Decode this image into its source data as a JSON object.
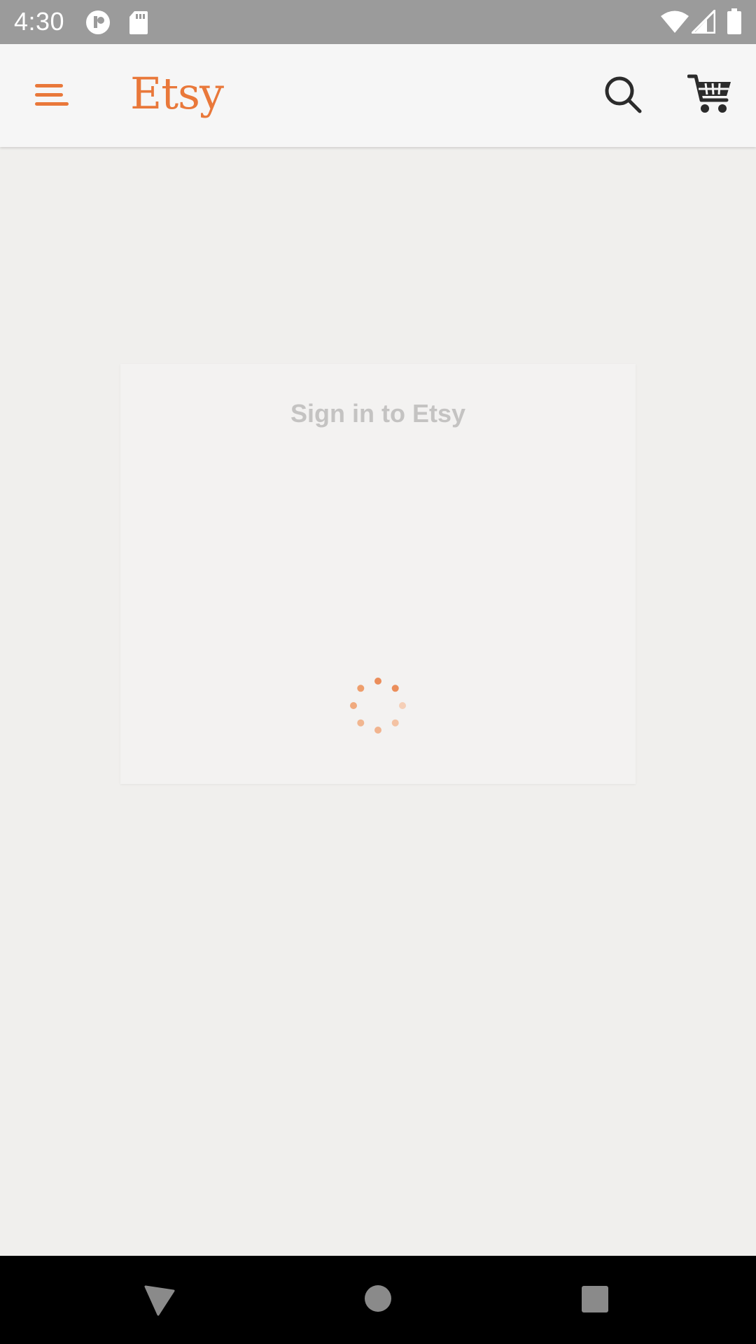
{
  "status_bar": {
    "time": "4:30",
    "icons": [
      "app-notification-icon",
      "sd-card-icon",
      "wifi-icon",
      "cell-signal-icon",
      "battery-icon"
    ]
  },
  "app_bar": {
    "menu_icon": "hamburger-menu-icon",
    "logo_text": "Etsy",
    "search_icon": "search-icon",
    "cart_icon": "cart-icon",
    "accent_color": "#e9783a"
  },
  "signin": {
    "title": "Sign in to Etsy",
    "loading_indicator": "loading-spinner-icon"
  },
  "nav_bar": {
    "back_icon": "back-icon",
    "home_icon": "home-icon",
    "recents_icon": "recents-icon"
  }
}
